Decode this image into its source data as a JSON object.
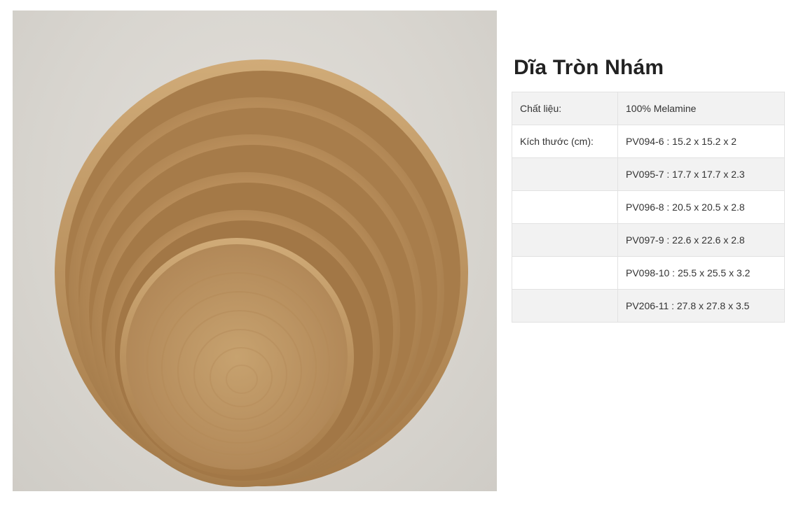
{
  "product": {
    "title": "Dĩa Tròn Nhám",
    "image": {
      "subject": "stacked-round-plates",
      "colors": {
        "background": "#d9d6d0",
        "plate_light": "#c7a06d",
        "plate_mid": "#b98f5c",
        "plate_dark": "#9c7444"
      }
    }
  },
  "specs": [
    {
      "label": "Chất liệu:",
      "value": "100% Melamine"
    },
    {
      "label": "Kích thước (cm):",
      "value": "PV094-6 : 15.2 x 15.2 x 2"
    },
    {
      "label": "",
      "value": "PV095-7 : 17.7 x 17.7 x 2.3"
    },
    {
      "label": "",
      "value": "PV096-8 : 20.5 x 20.5 x 2.8"
    },
    {
      "label": "",
      "value": "PV097-9 : 22.6 x 22.6 x 2.8"
    },
    {
      "label": "",
      "value": "PV098-10 : 25.5 x 25.5 x 3.2"
    },
    {
      "label": "",
      "value": "PV206-11 : 27.8 x 27.8 x 3.5"
    }
  ]
}
